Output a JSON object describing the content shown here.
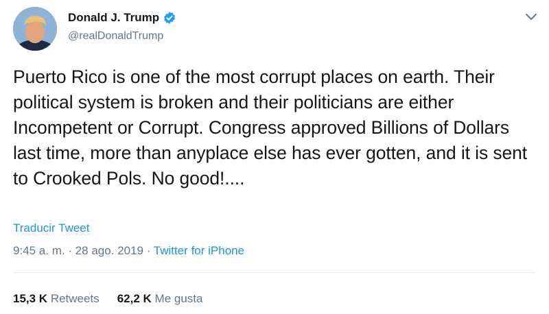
{
  "author": {
    "display_name": "Donald J. Trump",
    "handle": "@realDonaldTrump",
    "verified": true,
    "verified_color": "#1da1f2"
  },
  "tweet": {
    "text": "Puerto Rico is one of the most corrupt places on earth. Their political system is broken and their politicians are either Incompetent or Corrupt. Congress approved Billions of Dollars last time, more than anyplace else has ever gotten, and it is sent to Crooked Pols. No good!....",
    "translate_label": "Traducir Tweet",
    "timestamp": "9:45 a. m. · 28 ago. 2019",
    "separator": " · ",
    "source": "Twitter for iPhone"
  },
  "stats": {
    "retweets_count": "15,3 K",
    "retweets_label": "Retweets",
    "likes_count": "62,2 K",
    "likes_label": "Me gusta"
  },
  "colors": {
    "link": "#1b95e0",
    "muted": "#657786",
    "text": "#14171a"
  }
}
